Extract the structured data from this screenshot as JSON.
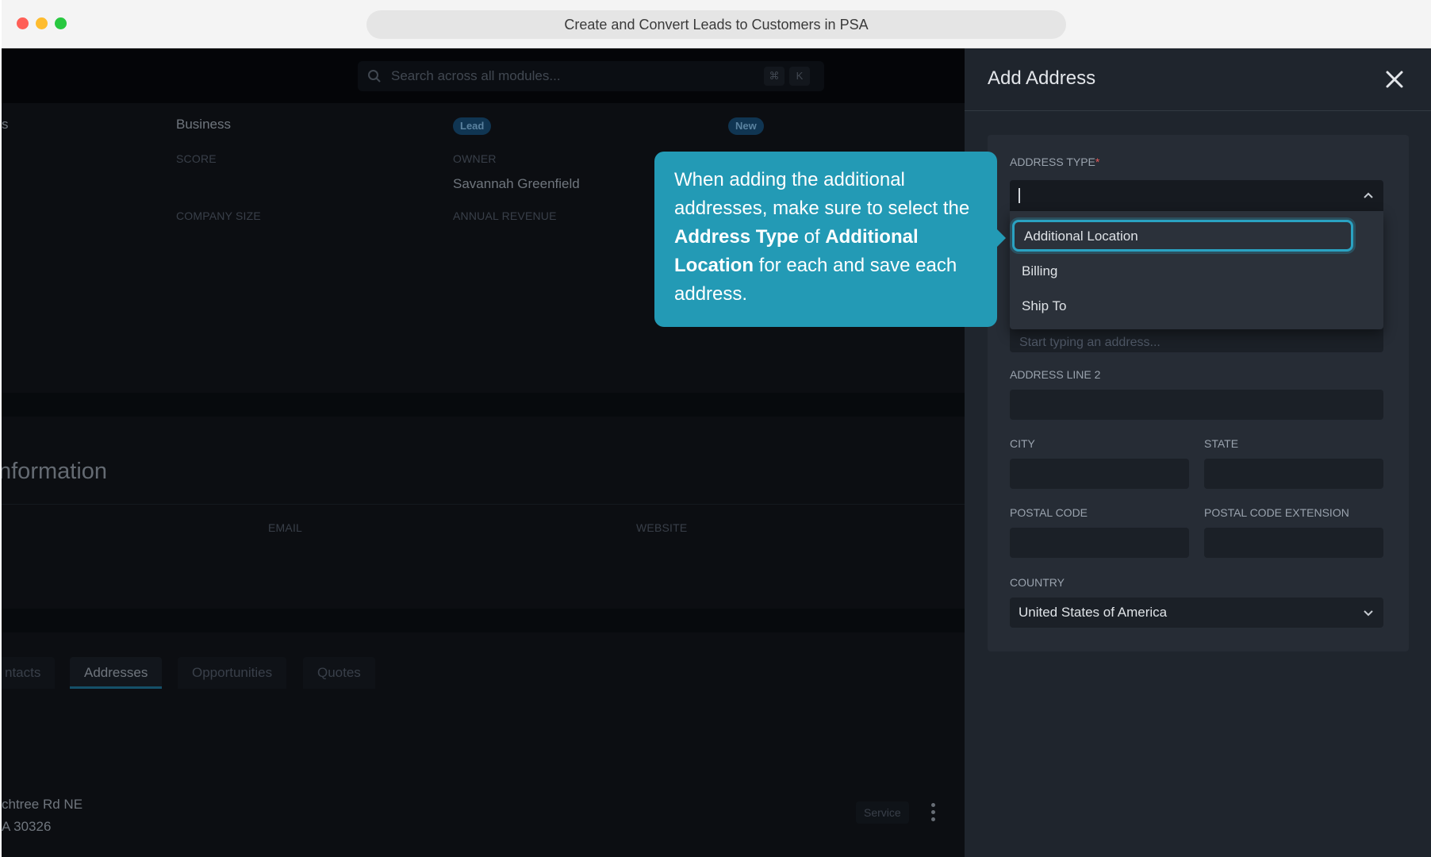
{
  "browser": {
    "url_title": "Create and Convert Leads to Customers in PSA"
  },
  "app": {
    "search": {
      "placeholder": "Search across all modules...",
      "shortcut_cmd": "⌘",
      "shortcut_key": "K"
    },
    "overview": {
      "type_value_partial": "s",
      "business_value": "Business",
      "stage_badge": "Lead",
      "status_badge": "New",
      "score_label": "SCORE",
      "owner_label": "OWNER",
      "owner_value": "Savannah Greenfield",
      "company_size_label": "COMPANY SIZE",
      "annual_revenue_label": "ANNUAL REVENUE"
    },
    "contact_info": {
      "title_partial": "nformation",
      "email_label": "EMAIL",
      "website_label": "WEBSITE"
    },
    "tabs": [
      {
        "label": "ntacts",
        "active": false
      },
      {
        "label": "Addresses",
        "active": true
      },
      {
        "label": "Opportunities",
        "active": false
      },
      {
        "label": "Quotes",
        "active": false
      }
    ],
    "address_row": {
      "line1_partial": "chtree Rd NE",
      "line2_partial": "A 30326",
      "badge": "Service"
    }
  },
  "drawer": {
    "title": "Add Address",
    "address_type": {
      "label": "ADDRESS TYPE",
      "required_mark": "*",
      "options": [
        "Additional Location",
        "Billing",
        "Ship To"
      ],
      "highlighted_option": "Additional Location"
    },
    "address_line1_placeholder": "Start typing an address...",
    "address_line2_label": "ADDRESS LINE 2",
    "city_label": "CITY",
    "state_label": "STATE",
    "postal_code_label": "POSTAL CODE",
    "postal_code_ext_label": "POSTAL CODE EXTENSION",
    "country_label": "COUNTRY",
    "country_value": "United States of America"
  },
  "callout": {
    "text_1": "When adding the additional addresses, make sure to select the ",
    "bold_1": "Address Type",
    "text_2": " of ",
    "bold_2": "Additional Location",
    "text_3": " for each and save each address."
  },
  "colors": {
    "accent": "#239ab5",
    "badge_blue": "#174a72",
    "required": "#e35a5a"
  }
}
